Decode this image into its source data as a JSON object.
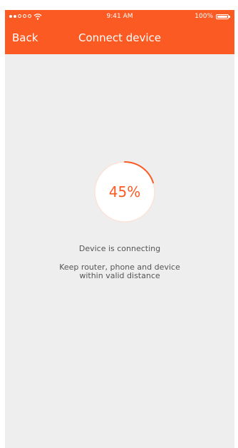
{
  "status_bar": {
    "time": "9:41 AM",
    "battery_pct": "100%"
  },
  "header": {
    "back_label": "Back",
    "title": "Connect device"
  },
  "progress": {
    "percent_label": "45%",
    "value": 0.2
  },
  "messages": {
    "status": "Device is connecting",
    "hint_line1": "Keep router, phone and device",
    "hint_line2": "within valid distance"
  },
  "colors": {
    "accent": "#fb5a23",
    "background": "#eeeeee"
  },
  "icons": [
    "signal-dots-icon",
    "wifi-icon",
    "battery-icon"
  ]
}
